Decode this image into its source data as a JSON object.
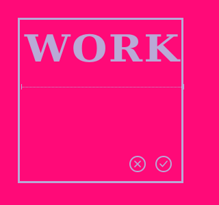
{
  "card": {
    "title": "WORK"
  },
  "actions": {
    "cancel_icon": "close-icon",
    "confirm_icon": "check-icon"
  },
  "colors": {
    "background": "#ff0a78",
    "accent": "#b9a9d6"
  }
}
